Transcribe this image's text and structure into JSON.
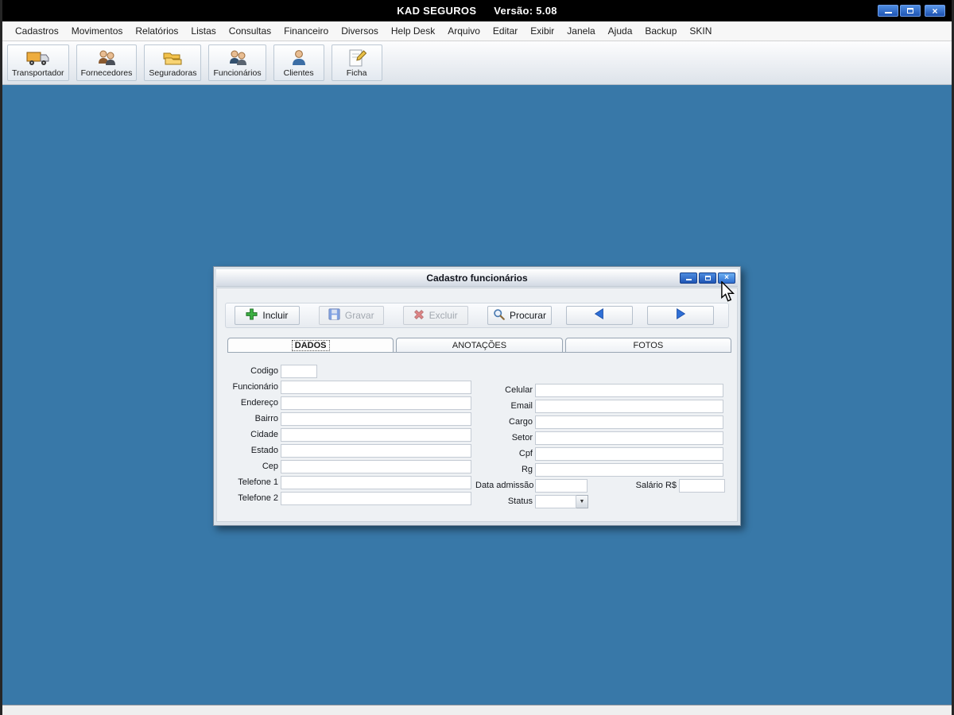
{
  "window": {
    "title": "KAD SEGUROS",
    "version_label": "Versão: 5.08"
  },
  "colors": {
    "desktop_blue": "#3878a8",
    "titlebar_black": "#000000",
    "accent_button_blue": "#2e6fd6"
  },
  "menu": {
    "items": [
      "Cadastros",
      "Movimentos",
      "Relatórios",
      "Listas",
      "Consultas",
      "Financeiro",
      "Diversos",
      "Help Desk",
      "Arquivo",
      "Editar",
      "Exibir",
      "Janela",
      "Ajuda",
      "Backup",
      "SKIN"
    ]
  },
  "toolbar": {
    "buttons": [
      {
        "label": "Transportador",
        "icon": "truck-icon"
      },
      {
        "label": "Fornecedores",
        "icon": "people-icon"
      },
      {
        "label": "Seguradoras",
        "icon": "folders-icon"
      },
      {
        "label": "Funcionários",
        "icon": "employees-icon"
      },
      {
        "label": "Clientes",
        "icon": "person-icon"
      },
      {
        "label": "Ficha",
        "icon": "document-pencil-icon"
      }
    ]
  },
  "dialog": {
    "title": "Cadastro funcionários",
    "controls": {
      "minimize": "minimize-icon",
      "maximize": "maximize-icon",
      "close": "close-icon"
    },
    "actions": [
      {
        "label": "Incluir",
        "icon": "plus-icon",
        "enabled": true
      },
      {
        "label": "Gravar",
        "icon": "save-icon",
        "enabled": false
      },
      {
        "label": "Excluir",
        "icon": "delete-icon",
        "enabled": false
      },
      {
        "label": "Procurar",
        "icon": "search-icon",
        "enabled": true
      }
    ],
    "nav": {
      "prev": "arrow-left-icon",
      "next": "arrow-right-icon"
    },
    "tabs": [
      {
        "label": "DADOS",
        "active": true
      },
      {
        "label": "ANOTAÇÕES",
        "active": false
      },
      {
        "label": "FOTOS",
        "active": false
      }
    ],
    "form": {
      "left": [
        "Codigo",
        "Funcionário",
        "Endereço",
        "Bairro",
        "Cidade",
        "Estado",
        "Cep",
        "Telefone 1",
        "Telefone 2"
      ],
      "right": [
        "Celular",
        "Email",
        "Cargo",
        "Setor",
        "Cpf",
        "Rg",
        "Data admissão",
        "Status"
      ],
      "salario_label": "Salário R$",
      "values": {
        "all_fields": ""
      }
    }
  }
}
